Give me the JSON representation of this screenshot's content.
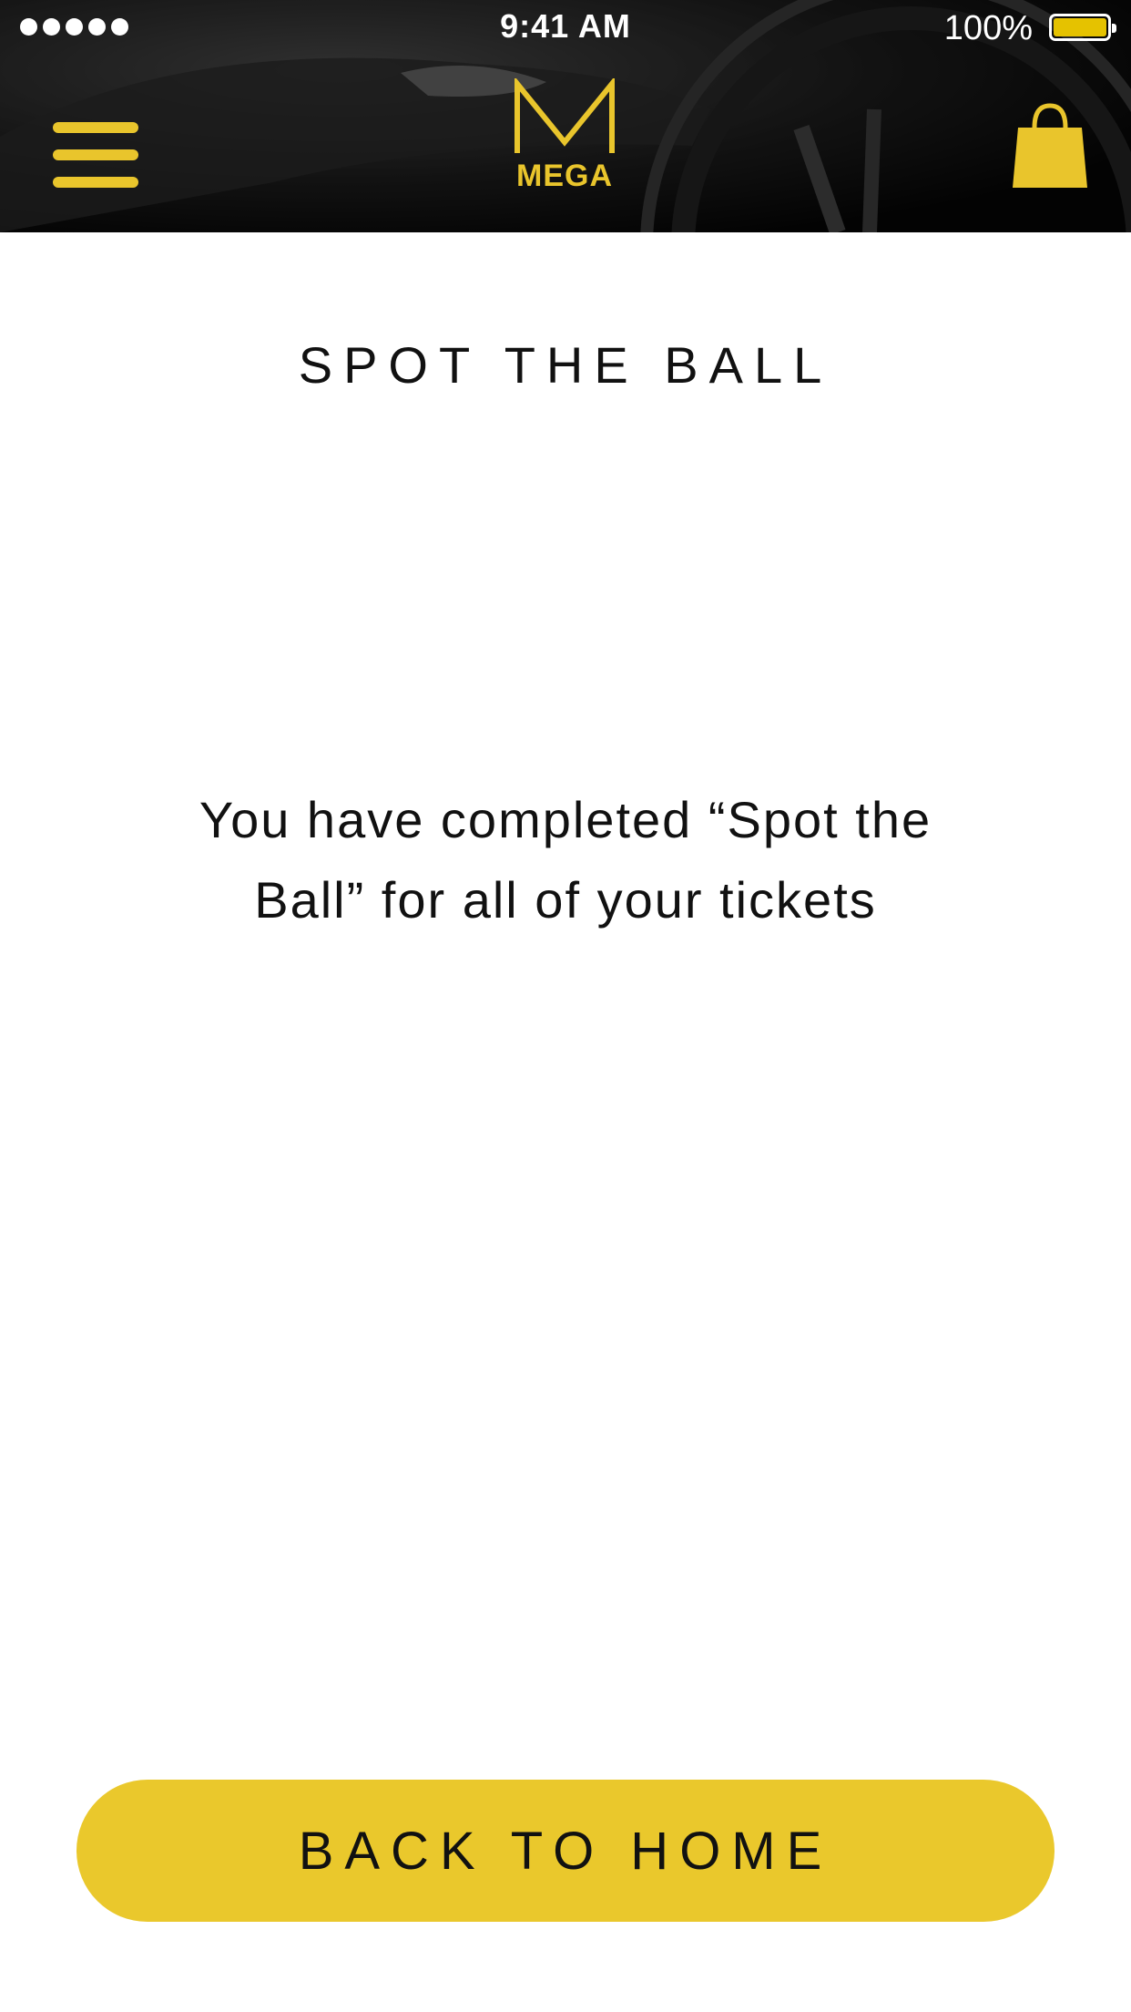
{
  "status_bar": {
    "time": "9:41 AM",
    "battery_percent": "100%",
    "signal_bars": 5
  },
  "header": {
    "logo_letter": "M",
    "logo_text": "MEGA",
    "menu_icon": "hamburger-menu-icon",
    "bag_icon": "shopping-bag-icon"
  },
  "page": {
    "title": "SPOT THE BALL",
    "message": "You have completed “Spot the Ball” for all of your tickets"
  },
  "actions": {
    "back_home_label": "BACK TO HOME"
  },
  "colors": {
    "accent": "#eac82c",
    "header_background": "#0b0b0b",
    "text": "#111111",
    "background": "#ffffff"
  }
}
